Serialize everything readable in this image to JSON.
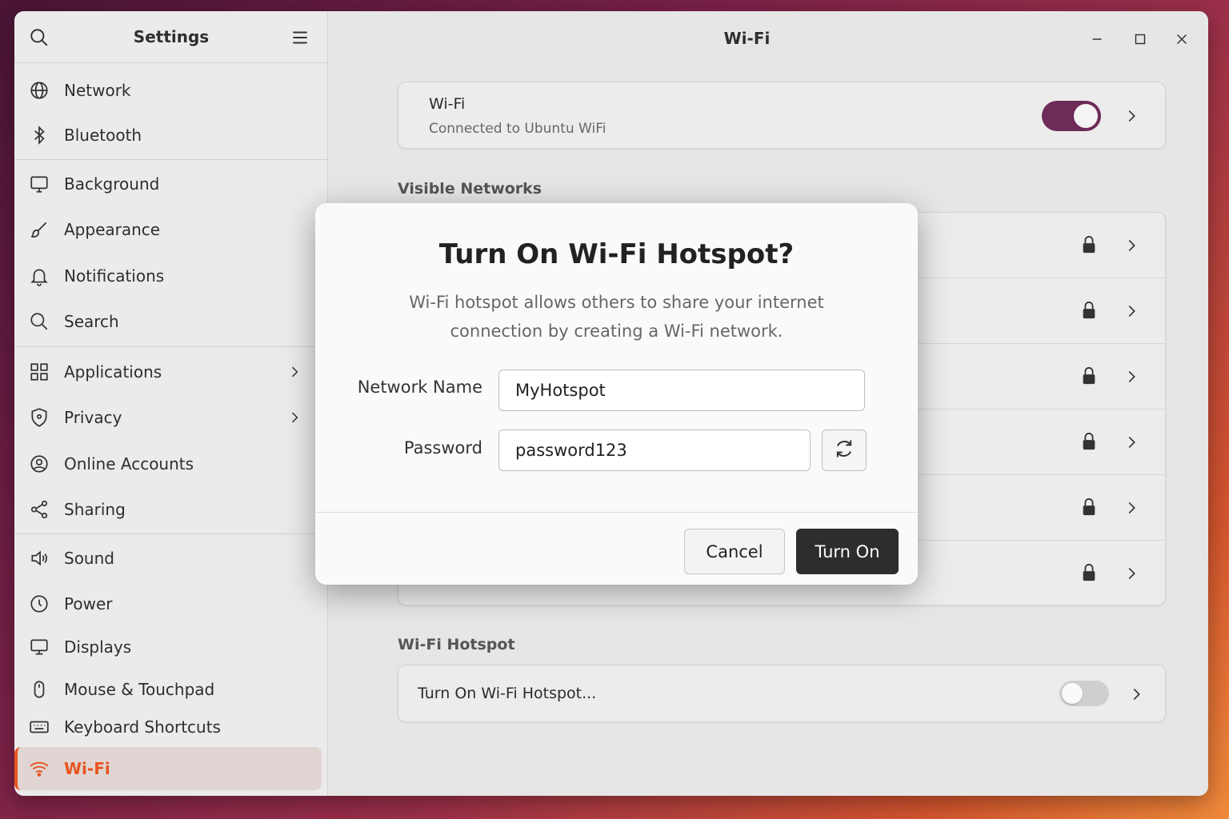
{
  "sidebar": {
    "title": "Settings",
    "items": [
      {
        "label": "Network",
        "icon": "globe-icon"
      },
      {
        "label": "Bluetooth",
        "icon": "bluetooth-icon"
      },
      {
        "label": "Background",
        "icon": "monitor-icon"
      },
      {
        "label": "Appearance",
        "icon": "brush-icon"
      },
      {
        "label": "Notifications",
        "icon": "bell-icon"
      },
      {
        "label": "Search",
        "icon": "search-icon"
      },
      {
        "label": "Applications",
        "icon": "grid-icon"
      },
      {
        "label": "Privacy",
        "icon": "shield-icon"
      },
      {
        "label": "Online Accounts",
        "icon": "user-circle-icon"
      },
      {
        "label": "Sharing",
        "icon": "share-icon"
      },
      {
        "label": "Sound",
        "icon": "speaker-icon"
      },
      {
        "label": "Power",
        "icon": "power-icon"
      },
      {
        "label": "Displays",
        "icon": "display-icon"
      },
      {
        "label": "Mouse & Touchpad",
        "icon": "mouse-icon"
      },
      {
        "label": "Keyboard Shortcuts",
        "icon": "keyboard-icon"
      },
      {
        "label": "Wi-Fi",
        "icon": "wifi-icon",
        "active": true
      }
    ]
  },
  "main": {
    "title": "Wi-Fi",
    "wifi_card": {
      "title": "Wi-Fi",
      "subtitle": "Connected to Ubuntu WiFi",
      "toggle_on": true
    },
    "visible_networks_label": "Visible Networks",
    "network_rows": 6,
    "hotspot_section_label": "Wi-Fi Hotspot",
    "hotspot_row_label": "Turn On Wi-Fi Hotspot...",
    "hotspot_toggle_on": false
  },
  "dialog": {
    "title": "Turn On Wi-Fi Hotspot?",
    "description": "Wi-Fi hotspot allows others to share your internet connection by creating a Wi-Fi network.",
    "network_name_label": "Network Name",
    "network_name_value": "MyHotspot",
    "password_label": "Password",
    "password_value": "password123",
    "cancel_label": "Cancel",
    "confirm_label": "Turn On"
  },
  "colors": {
    "accent": "#e95420",
    "toggle_on": "#6e2a59",
    "primary_button": "#2d2d2d"
  }
}
